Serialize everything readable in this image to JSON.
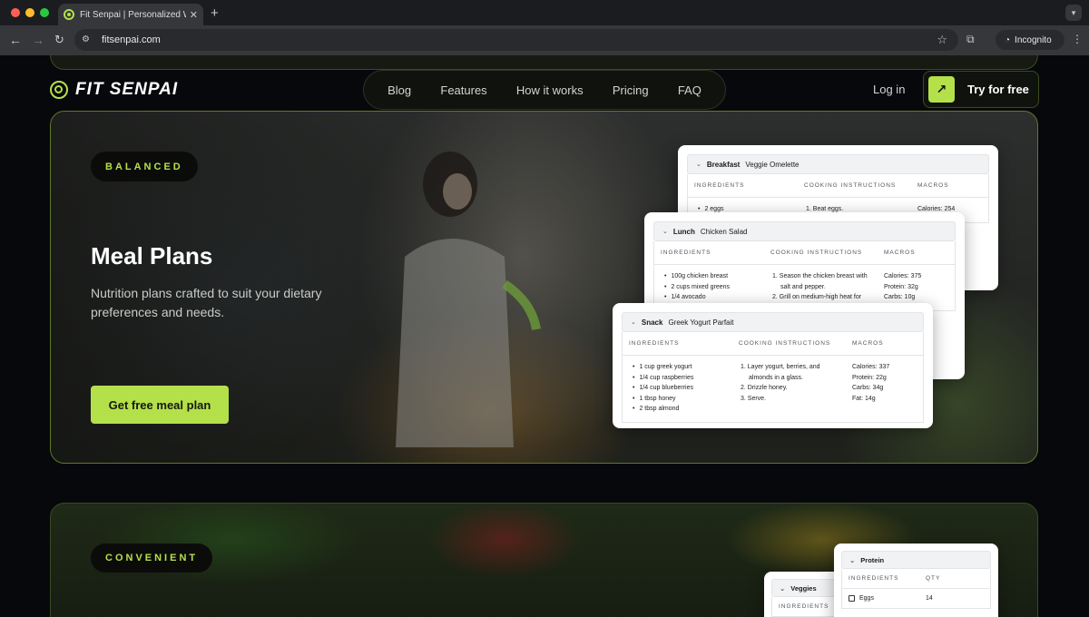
{
  "browser": {
    "tab_title": "Fit Senpai | Personalized Wor",
    "tab_close": "✕",
    "new_tab": "+",
    "url": "fitsenpai.com",
    "incognito_label": "Incognito"
  },
  "header": {
    "brand": "FIT SENPAI",
    "nav": [
      "Blog",
      "Features",
      "How it works",
      "Pricing",
      "FAQ"
    ],
    "login": "Log in",
    "cta": "Try for free"
  },
  "hero": {
    "badge": "BALANCED",
    "title": "Meal Plans",
    "subtitle": "Nutrition plans crafted to suit your dietary preferences and needs.",
    "button": "Get free meal plan"
  },
  "meal_columns": [
    "INGREDIENTS",
    "COOKING INSTRUCTIONS",
    "MACROS"
  ],
  "meals": [
    {
      "type": "Breakfast",
      "name": "Veggie Omelette",
      "ingredients": [
        "2 eggs"
      ],
      "instructions": [
        "1. Beat eggs."
      ],
      "macros": [
        "Calories: 254"
      ]
    },
    {
      "type": "Lunch",
      "name": "Chicken Salad",
      "ingredients": [
        "100g chicken breast",
        "2 cups mixed greens",
        "1/4 avocado"
      ],
      "instructions": [
        "1. Season the chicken breast with",
        "salt and pepper.",
        "2. Grill on medium-high heat for"
      ],
      "macros": [
        "Calories: 375",
        "Protein: 32g",
        "Carbs: 10g"
      ]
    },
    {
      "type": "Snack",
      "name": "Greek Yogurt Parfait",
      "ingredients": [
        "1 cup greek yogurt",
        "1/4 cup raspberries",
        "1/4 cup blueberries",
        "1 tbsp honey",
        "2 tbsp almond"
      ],
      "instructions": [
        "1. Layer yogurt, berries, and",
        "almonds in a glass.",
        "2. Drizzle honey.",
        "3. Serve."
      ],
      "macros": [
        "Calories: 337",
        "Protein: 22g",
        "Carbs: 34g",
        "Fat: 14g"
      ]
    }
  ],
  "second": {
    "badge": "CONVENIENT",
    "veggies_title": "Veggies",
    "veggies_col": "INGREDIENTS",
    "protein_title": "Protein",
    "protein_cols": [
      "INGREDIENTS",
      "QTY"
    ],
    "protein_item": "Eggs",
    "protein_qty": "14"
  },
  "colors": {
    "accent": "#b4e04a",
    "page_bg": "#07080c"
  }
}
